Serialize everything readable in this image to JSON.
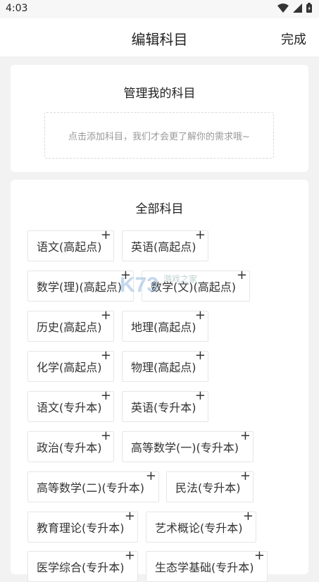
{
  "status": {
    "time": "4:03"
  },
  "header": {
    "title": "编辑科目",
    "done_label": "完成"
  },
  "my_subjects": {
    "title": "管理我的科目",
    "placeholder": "点击添加科目，我们才会更了解你的需求哦~"
  },
  "all_subjects": {
    "title": "全部科目",
    "add_symbol": "+",
    "items": [
      "语文(高起点)",
      "英语(高起点)",
      "数学(理)(高起点)",
      "数学(文)(高起点)",
      "历史(高起点)",
      "地理(高起点)",
      "化学(高起点)",
      "物理(高起点)",
      "语文(专升本)",
      "英语(专升本)",
      "政治(专升本)",
      "高等数学(一)(专升本)",
      "高等数学(二)(专升本)",
      "民法(专升本)",
      "教育理论(专升本)",
      "艺术概论(专升本)",
      "医学综合(专升本)",
      "生态学基础(专升本)"
    ]
  },
  "watermark": {
    "text": "游戏之家"
  }
}
